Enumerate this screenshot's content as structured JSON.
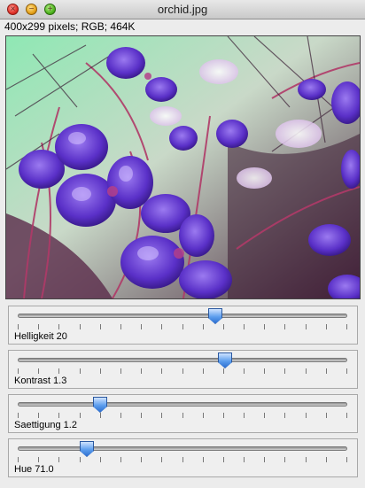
{
  "window": {
    "title": "orchid.jpg",
    "controls": [
      {
        "name": "close-button",
        "icon": "close-icon",
        "color": "#e0322a"
      },
      {
        "name": "minimize-button",
        "icon": "minimize-icon",
        "color": "#e5a21a"
      },
      {
        "name": "zoom-button",
        "icon": "zoom-icon",
        "color": "#4fb41f"
      }
    ]
  },
  "image_info": "400x299 pixels; RGB; 464K",
  "image": {
    "description_colors": {
      "background": "#7fe0a8",
      "petal": "#6b3fd0",
      "stem": "#b0406a",
      "dark": "#3a1a3a"
    }
  },
  "sliders": [
    {
      "name": "helligkeit",
      "label": "Helligkeit 20",
      "level": 0.6
    },
    {
      "name": "kontrast",
      "label": "Kontrast 1.3",
      "level": 0.63
    },
    {
      "name": "saettigung",
      "label": "Saettigung 1.2",
      "level": 0.25
    },
    {
      "name": "hue",
      "label": "Hue 71.0",
      "level": 0.21
    }
  ]
}
